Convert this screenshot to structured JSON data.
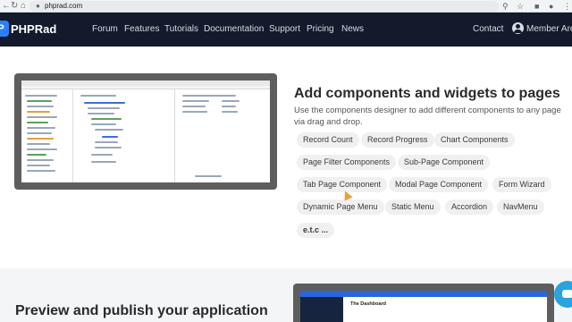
{
  "browser": {
    "url": "phprad.com",
    "back_icon": "arrow-left-icon",
    "forward_icon": "arrow-right-icon",
    "reload_icon": "reload-icon",
    "home_icon": "home-icon",
    "lock_icon": "lock-icon"
  },
  "nav": {
    "logo": "PHPRad",
    "links": [
      "Forum",
      "Features",
      "Tutorials",
      "Documentation",
      "Support",
      "Pricing",
      "News"
    ],
    "contact": "Contact",
    "member": "Member Area"
  },
  "section_components": {
    "title": "Add components and widgets to pages",
    "description": "Use the components designer to add different components to any page via drag and drop.",
    "chips": [
      "Record Count",
      "Record Progress",
      "Chart Components",
      "Page Filter Components",
      "Sub-Page Component",
      "Tab Page Component",
      "Modal Page Component",
      "Form Wizard",
      "Dynamic Page Menu",
      "Static Menu",
      "Accordion",
      "NavMenu",
      "e.t.c ..."
    ]
  },
  "section_preview": {
    "title": "Preview and publish your application",
    "dashboard_label": "The Dashboard"
  },
  "colors": {
    "nav_bg": "#121a2b",
    "chip_bg": "#f0f0f0",
    "chat": "#29a3e0"
  }
}
